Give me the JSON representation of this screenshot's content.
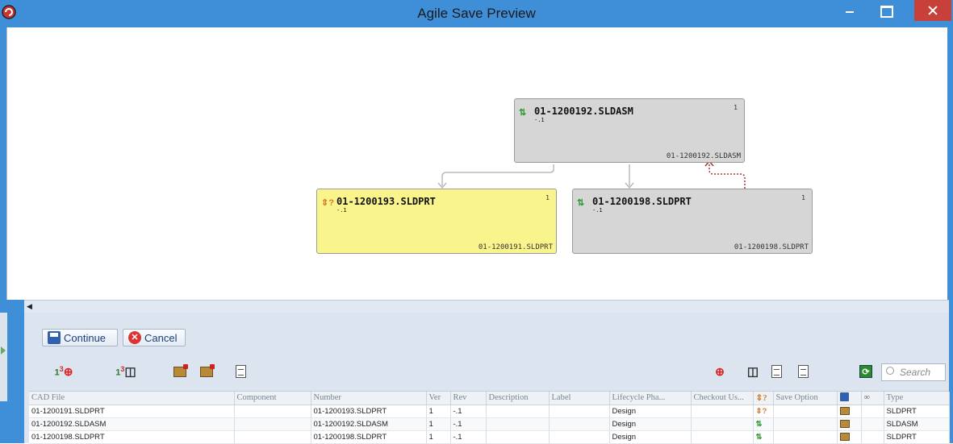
{
  "window": {
    "title": "Agile Save Preview"
  },
  "graph": {
    "nodes": [
      {
        "title": "01-1200192.SLDASM",
        "sub": "-.1",
        "qty": "1",
        "file": "01-1200192.SLDASM",
        "status_icon": "green-arrows-icon",
        "selected": false
      },
      {
        "title": "01-1200193.SLDPRT",
        "sub": "-.1",
        "qty": "1",
        "file": "01-1200191.SLDPRT",
        "status_icon": "swap-question-icon",
        "selected": true
      },
      {
        "title": "01-1200198.SLDPRT",
        "sub": "-.1",
        "qty": "1",
        "file": "01-1200198.SLDPRT",
        "status_icon": "green-arrows-icon",
        "selected": false
      }
    ]
  },
  "actions": {
    "continue_label": "Continue",
    "cancel_label": "Cancel"
  },
  "toolbar": {
    "search_placeholder": "Search",
    "qty_icon_text": "1",
    "qty_icon_sup": "3"
  },
  "table": {
    "columns": [
      "CAD File",
      "Component",
      "Number",
      "Ver",
      "Rev",
      "Description",
      "Label",
      "Lifecycle Pha...",
      "Checkout Us...",
      "",
      "Save Option",
      "",
      "",
      "Type"
    ],
    "rows": [
      {
        "cad_file": "01-1200191.SLDPRT",
        "component": "",
        "number": "01-1200193.SLDPRT",
        "ver": "1",
        "rev": "-.1",
        "description": "",
        "label": "",
        "lifecycle": "Design",
        "checkout": "",
        "status_icon": "swap-question-icon",
        "save_option": "",
        "type": "SLDPRT"
      },
      {
        "cad_file": "01-1200192.SLDASM",
        "component": "",
        "number": "01-1200192.SLDASM",
        "ver": "1",
        "rev": "-.1",
        "description": "",
        "label": "",
        "lifecycle": "Design",
        "checkout": "",
        "status_icon": "green-arrows-icon",
        "save_option": "",
        "type": "SLDASM"
      },
      {
        "cad_file": "01-1200198.SLDPRT",
        "component": "",
        "number": "01-1200198.SLDPRT",
        "ver": "1",
        "rev": "-.1",
        "description": "",
        "label": "",
        "lifecycle": "Design",
        "checkout": "",
        "status_icon": "green-arrows-icon",
        "save_option": "",
        "type": "SLDPRT"
      }
    ]
  },
  "colors": {
    "titlebar": "#3e8fd8",
    "close_button": "#c7413a",
    "selected_node": "#faf48c",
    "node": "#d6d6d6"
  }
}
